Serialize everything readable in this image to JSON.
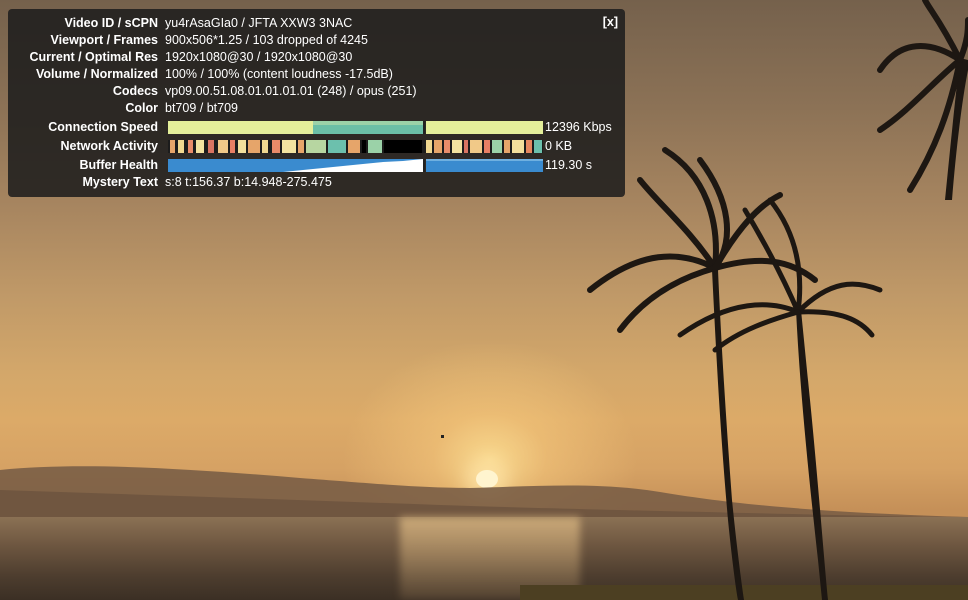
{
  "panel": {
    "close_label": "[x]",
    "rows": [
      {
        "label": "Video ID / sCPN",
        "value": "yu4rAsaGIa0 / JFTA XXW3 3NAC"
      },
      {
        "label": "Viewport / Frames",
        "value": "900x506*1.25 / 103 dropped of 4245"
      },
      {
        "label": "Current / Optimal Res",
        "value": "1920x1080@30 / 1920x1080@30"
      },
      {
        "label": "Volume / Normalized",
        "value": "100% / 100% (content loudness -17.5dB)"
      },
      {
        "label": "Codecs",
        "value": "vp09.00.51.08.01.01.01.01 (248) / opus (251)"
      },
      {
        "label": "Color",
        "value": "bt709 / bt709"
      }
    ],
    "graphs": {
      "connection": {
        "label": "Connection Speed",
        "value": "12396 Kbps"
      },
      "network": {
        "label": "Network Activity",
        "value": "0 KB"
      },
      "buffer": {
        "label": "Buffer Health",
        "value": "119.30 s"
      }
    },
    "mystery": {
      "label": "Mystery Text",
      "value": "s:8 t:156.37 b:14.948-275.475"
    }
  },
  "colors": {
    "panel_bg": "#1c1c1c",
    "conn_yellow": "#e4ef9a",
    "conn_teal": "#5ab8a4",
    "buffer_blue": "#3a8bcf",
    "network_orange": "#e6875f"
  }
}
